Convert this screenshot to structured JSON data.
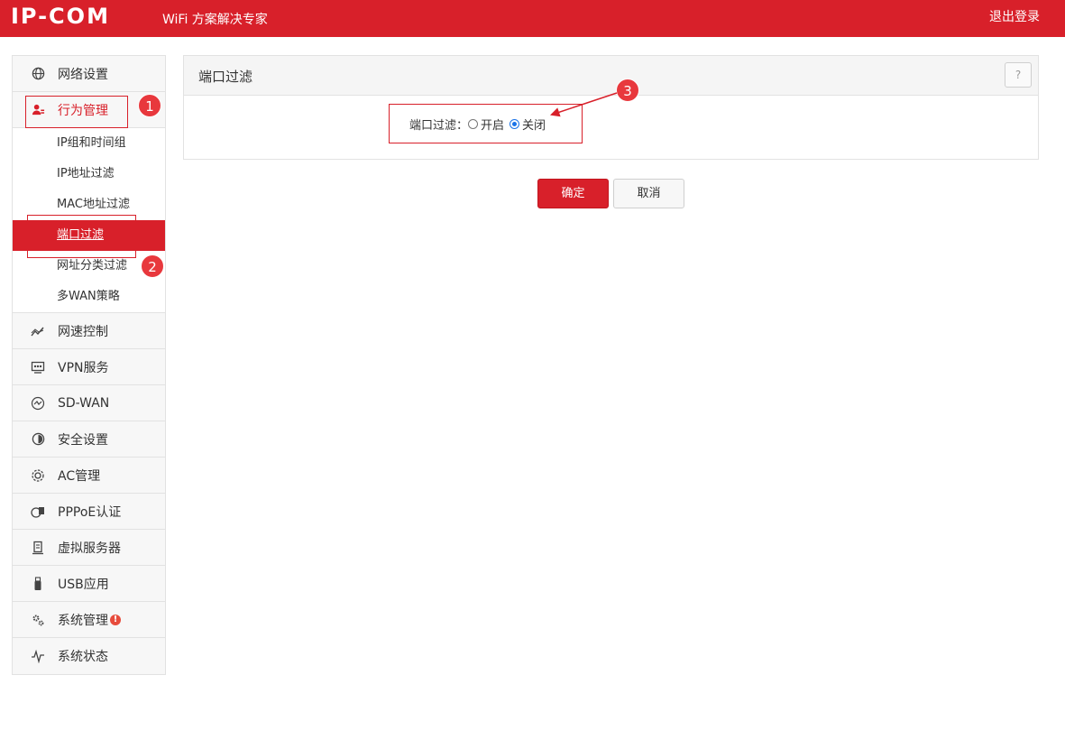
{
  "header": {
    "logo": "IP-COM",
    "tagline": "WiFi 方案解决专家",
    "logout": "退出登录"
  },
  "sidebar": {
    "items": [
      {
        "label": "网络设置",
        "icon": "globe-icon"
      },
      {
        "label": "行为管理",
        "icon": "user-management-icon"
      },
      {
        "label": "网速控制",
        "icon": "speed-chart-icon"
      },
      {
        "label": "VPN服务",
        "icon": "vpn-icon"
      },
      {
        "label": "SD-WAN",
        "icon": "sdwan-icon"
      },
      {
        "label": "安全设置",
        "icon": "shield-icon"
      },
      {
        "label": "AC管理",
        "icon": "ac-gear-icon"
      },
      {
        "label": "PPPoE认证",
        "icon": "pppoe-icon"
      },
      {
        "label": "虚拟服务器",
        "icon": "server-icon"
      },
      {
        "label": "USB应用",
        "icon": "usb-icon"
      },
      {
        "label": "系统管理",
        "icon": "system-gears-icon",
        "badge": "!"
      },
      {
        "label": "系统状态",
        "icon": "pulse-icon"
      }
    ],
    "subitems": [
      {
        "label": "IP组和时间组"
      },
      {
        "label": "IP地址过滤"
      },
      {
        "label": "MAC地址过滤"
      },
      {
        "label": "端口过滤"
      },
      {
        "label": "网址分类过滤"
      },
      {
        "label": "多WAN策略"
      }
    ]
  },
  "panel": {
    "title": "端口过滤",
    "help": "?",
    "field_label": "端口过滤：",
    "options": [
      "开启",
      "关闭"
    ],
    "selected": "关闭"
  },
  "buttons": {
    "ok": "确定",
    "cancel": "取消"
  },
  "annotations": [
    "1",
    "2",
    "3"
  ],
  "colors": {
    "brand_red": "#d8202a",
    "radio_blue": "#1a73e8"
  }
}
